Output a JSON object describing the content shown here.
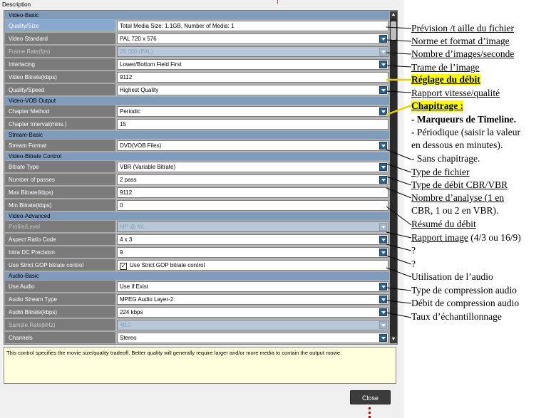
{
  "dialog": {
    "title": "Description",
    "help_text": "This control specifies the movie size/quality tradeoff.  Better quality will generally require larger and/or more media to contain the output movie.",
    "close_label": "Close"
  },
  "properties": [
    {
      "kind": "section",
      "label": "Video-Basic"
    },
    {
      "kind": "row",
      "label": "Quality/Size",
      "value": "Total Media Size: 1.1GB, Number of Media: 1",
      "control": "text",
      "selected": true
    },
    {
      "kind": "row",
      "label": "Video Standard",
      "value": "PAL  720 x 576",
      "control": "dropdown"
    },
    {
      "kind": "row",
      "label": "Frame Rate(fps)",
      "value": "25.000 (PAL)",
      "control": "dropdown",
      "disabled": true
    },
    {
      "kind": "row",
      "label": "Interlacing",
      "value": "Lower/Bottom Field First",
      "control": "dropdown"
    },
    {
      "kind": "row",
      "label": "Video Bitrate(kbps)",
      "value": "9112",
      "control": "text"
    },
    {
      "kind": "row",
      "label": "Quality/Speed",
      "value": "Highest Quality",
      "control": "dropdown"
    },
    {
      "kind": "section",
      "label": "Video-VOB Output"
    },
    {
      "kind": "row",
      "label": "Chapter Method",
      "value": "Periodic",
      "control": "dropdown"
    },
    {
      "kind": "row",
      "label": "Chapter Interval(mins.)",
      "value": "15",
      "control": "text"
    },
    {
      "kind": "section",
      "label": "Stream-Basic"
    },
    {
      "kind": "row",
      "label": "Stream Format",
      "value": "DVD(VOB Files)",
      "control": "dropdown"
    },
    {
      "kind": "section",
      "label": "Video-Bitrate Control"
    },
    {
      "kind": "row",
      "label": "Bitrate Type",
      "value": "VBR (Variable Bitrate)",
      "control": "dropdown"
    },
    {
      "kind": "row",
      "label": "Number of passes",
      "value": "2 pass",
      "control": "dropdown"
    },
    {
      "kind": "row",
      "label": "Max Bitrate(kbps)",
      "value": "9112",
      "control": "text"
    },
    {
      "kind": "row",
      "label": "Min Bitrate(kbps)",
      "value": "0",
      "control": "text"
    },
    {
      "kind": "section",
      "label": "Video-Advanced"
    },
    {
      "kind": "row",
      "label": "Profile/Level",
      "value": "MP @ ML",
      "control": "dropdown",
      "disabled": true
    },
    {
      "kind": "row",
      "label": "Aspect Ratio Code",
      "value": "4 x 3",
      "control": "dropdown"
    },
    {
      "kind": "row",
      "label": "Intra DC Precision",
      "value": "9",
      "control": "dropdown"
    },
    {
      "kind": "row",
      "label": "Use Strict GOP bitrate control",
      "value": "Use Strict GOP bitrate control",
      "control": "checkbox",
      "checked": true
    },
    {
      "kind": "section",
      "label": "Audio-Basic"
    },
    {
      "kind": "row",
      "label": "Use Audio",
      "value": "Use if Exist",
      "control": "dropdown"
    },
    {
      "kind": "row",
      "label": "Audio Stream Type",
      "value": "MPEG Audio Layer-2",
      "control": "dropdown"
    },
    {
      "kind": "row",
      "label": "Audio Bitrate(kbps)",
      "value": "224 kbps",
      "control": "dropdown"
    },
    {
      "kind": "row",
      "label": "Sample Rate(kHz)",
      "value": "48.0",
      "control": "dropdown",
      "disabled": true
    },
    {
      "kind": "row",
      "label": "Channels",
      "value": "Stereo",
      "control": "dropdown"
    }
  ],
  "annotations": {
    "file_size": "Prévision /t aille du fichier",
    "video_standard": "Norme et format d’image",
    "frame_rate": "Nombre d’images/seconde",
    "interlacing": "Trame de l’image",
    "bitrate": "Réglage du débit",
    "quality_speed": "Rapport vitesse/qualité",
    "chapter_title": "Chapitrage :",
    "chapter_line1": "- Marqueurs de Timeline.",
    "chapter_line2": "- Périodique (saisir la valeur",
    "chapter_line3": "en dessous en minutes).",
    "chapter_line4": "- Sans chapitrage.",
    "file_type": "Type de fichier",
    "bitrate_type": "Type de débit CBR/VBR",
    "passes_line1": "Nombre d’analyse (1 en",
    "passes_line2": "CBR, 1 ou 2 en VBR).",
    "bitrate_summary": "Résumé du débit",
    "aspect_main": "Rapport image",
    "aspect_suffix": " (4/3 ou 16/9)",
    "unknown_1": "?",
    "unknown_2": "?",
    "use_audio": "Utilisation de l’audio",
    "audio_type": "Type de compression audio",
    "audio_bitrate": "Débit de compression audio",
    "sample_rate": "Taux d’échantillonnage"
  },
  "colors": {
    "highlight": "#ffff00",
    "section_header": "#7f9cbd",
    "help_background": "#ffffdd",
    "arrow_marker": "#b00000"
  }
}
